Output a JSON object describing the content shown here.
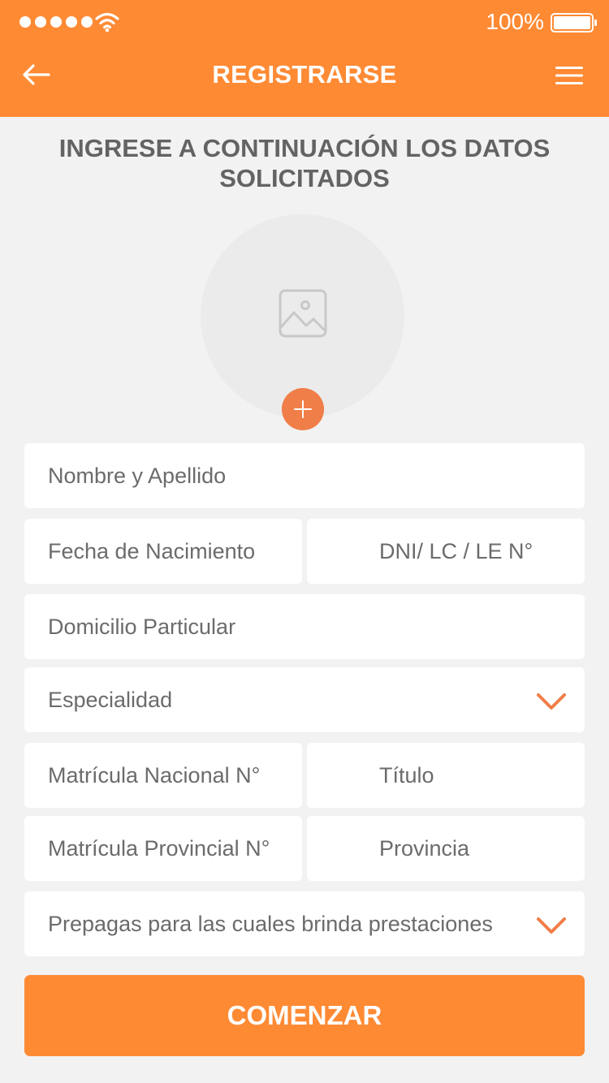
{
  "colors": {
    "primary": "#ff8a34",
    "accent": "#f07e48",
    "background": "#f2f2f2",
    "field_bg": "#ffffff",
    "text": "#6b6b6b"
  },
  "status_bar": {
    "battery_percent": "100%",
    "signal_icon": "signal-dots-icon",
    "wifi_icon": "wifi-icon",
    "battery_icon": "battery-icon"
  },
  "header": {
    "title": "REGISTRARSE",
    "back_icon": "arrow-left-icon",
    "menu_icon": "hamburger-menu-icon"
  },
  "heading": "INGRESE A CONTINUACIÓN LOS DATOS SOLICITADOS",
  "photo": {
    "placeholder_icon": "image-placeholder-icon",
    "add_icon": "plus-icon"
  },
  "form": {
    "full_name": "Nombre y Apellido",
    "birth_date": "Fecha de Nacimiento",
    "document": "DNI/ LC / LE N°",
    "address": "Domicilio Particular",
    "specialty": "Especialidad",
    "national_license": "Matrícula Nacional N°",
    "degree": "Título",
    "provincial_license": "Matrícula Provincial N°",
    "province": "Provincia",
    "prepaid_plans": "Prepagas para las cuales brinda prestaciones"
  },
  "submit_label": "COMENZAR"
}
